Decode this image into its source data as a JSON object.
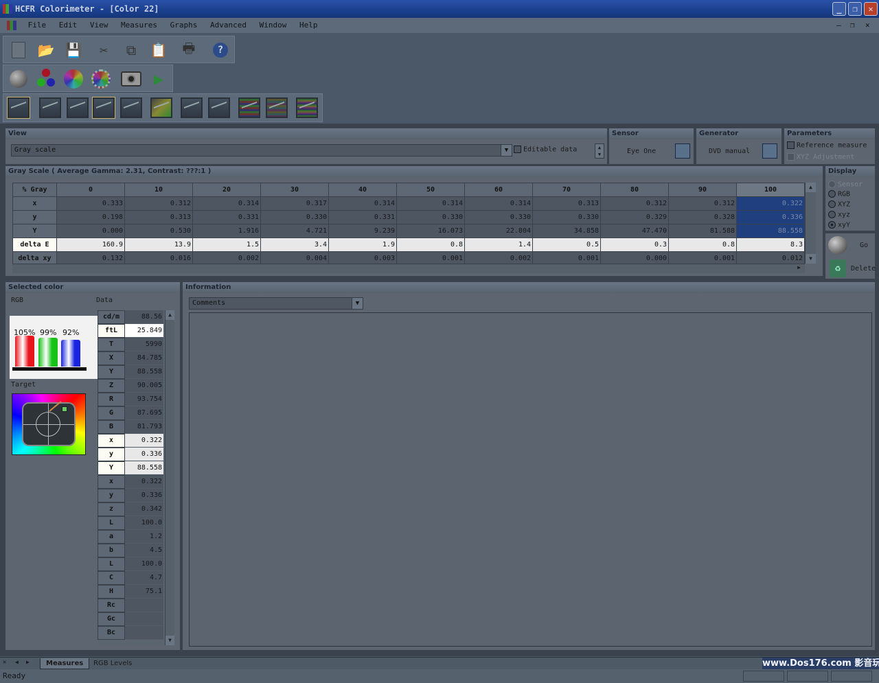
{
  "window": {
    "title": "HCFR Colorimeter - [Color 22]"
  },
  "menu": [
    "File",
    "Edit",
    "View",
    "Measures",
    "Graphs",
    "Advanced",
    "Window",
    "Help"
  ],
  "view_panel": {
    "header": "View",
    "select_value": "Gray scale",
    "editable_label": "Editable data"
  },
  "sensor_panel": {
    "header": "Sensor",
    "value": "Eye One"
  },
  "generator_panel": {
    "header": "Generator",
    "value": "DVD manual"
  },
  "parameters_panel": {
    "header": "Parameters",
    "reference_label": "Reference measure",
    "xyz_adjust_label": "XYZ Adjustment"
  },
  "gray_scale": {
    "header": "Gray Scale ( Average Gamma: 2.31, Contrast: ???:1 )",
    "corner": "% Gray",
    "columns": [
      "0",
      "10",
      "20",
      "30",
      "40",
      "50",
      "60",
      "70",
      "80",
      "90",
      "100"
    ],
    "rows": [
      {
        "label": "x",
        "values": [
          "0.333",
          "0.312",
          "0.314",
          "0.317",
          "0.314",
          "0.314",
          "0.314",
          "0.313",
          "0.312",
          "0.312",
          "0.322"
        ]
      },
      {
        "label": "y",
        "values": [
          "0.198",
          "0.313",
          "0.331",
          "0.330",
          "0.331",
          "0.330",
          "0.330",
          "0.330",
          "0.329",
          "0.328",
          "0.336"
        ]
      },
      {
        "label": "Y",
        "values": [
          "0.000",
          "0.530",
          "1.916",
          "4.721",
          "9.239",
          "16.073",
          "22.804",
          "34.858",
          "47.470",
          "81.588",
          "88.558"
        ]
      },
      {
        "label": "delta E",
        "values": [
          "160.9",
          "13.9",
          "1.5",
          "3.4",
          "1.9",
          "0.8",
          "1.4",
          "0.5",
          "0.3",
          "0.8",
          "8.3"
        ]
      },
      {
        "label": "delta xy",
        "values": [
          "0.132",
          "0.016",
          "0.002",
          "0.004",
          "0.003",
          "0.001",
          "0.002",
          "0.001",
          "0.000",
          "0.001",
          "0.012"
        ]
      }
    ]
  },
  "display_panel": {
    "header": "Display",
    "options": [
      "Sensor",
      "RGB",
      "XYZ",
      "xyz",
      "xyY"
    ],
    "selected": "xyY",
    "go_label": "Go",
    "delete_label": "Delete"
  },
  "selected_color": {
    "header": "Selected color",
    "rgb_label": "RGB",
    "data_label": "Data",
    "target_label": "Target",
    "rgb_percent": {
      "r": "105%",
      "g": "99%",
      "b": "92%"
    },
    "rgb_levels": {
      "r": 1.05,
      "g": 0.99,
      "b": 0.92
    },
    "colors": {
      "r": "#e8141c",
      "g": "#16c216",
      "b": "#1a24e0"
    },
    "data_rows": [
      {
        "label": "cd/m",
        "value": "88.56"
      },
      {
        "label": "ftL",
        "value": "25.849"
      },
      {
        "label": "T",
        "value": "5990"
      },
      {
        "label": "X",
        "value": "84.785"
      },
      {
        "label": "Y",
        "value": "88.558"
      },
      {
        "label": "Z",
        "value": "90.005"
      },
      {
        "label": "R",
        "value": "93.754"
      },
      {
        "label": "G",
        "value": "87.695"
      },
      {
        "label": "B",
        "value": "81.793"
      },
      {
        "label": "x",
        "value": "0.322"
      },
      {
        "label": "y",
        "value": "0.336"
      },
      {
        "label": "Y",
        "value": "88.558"
      },
      {
        "label": "x",
        "value": "0.322"
      },
      {
        "label": "y",
        "value": "0.336"
      },
      {
        "label": "z",
        "value": "0.342"
      },
      {
        "label": "L",
        "value": "100.0"
      },
      {
        "label": "a",
        "value": "1.2"
      },
      {
        "label": "b",
        "value": "4.5"
      },
      {
        "label": "L",
        "value": "100.0"
      },
      {
        "label": "C",
        "value": "4.7"
      },
      {
        "label": "H",
        "value": "75.1"
      },
      {
        "label": "Rc",
        "value": ""
      },
      {
        "label": "Gc",
        "value": ""
      },
      {
        "label": "Bc",
        "value": ""
      }
    ]
  },
  "information": {
    "header": "Information",
    "select_value": "Comments"
  },
  "tabs": [
    "Measures",
    "RGB Levels"
  ],
  "status": "Ready",
  "watermark": "www.Dos176.com 影音玩樂論壇"
}
